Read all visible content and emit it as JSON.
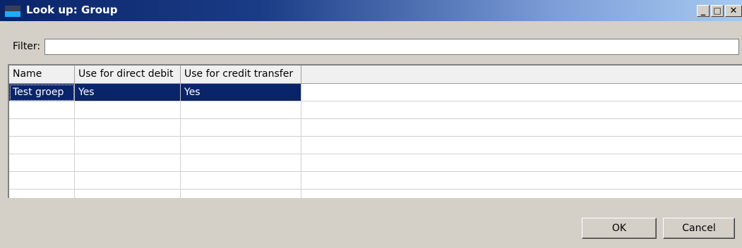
{
  "window": {
    "title": "Look up: Group",
    "minimize_glyph": "_",
    "maximize_glyph": "□",
    "close_glyph": "✕"
  },
  "filter": {
    "label": "Filter:",
    "value": ""
  },
  "table": {
    "columns": [
      "Name",
      "Use for direct debit",
      "Use for credit transfer"
    ],
    "rows": [
      {
        "name": "Test groep",
        "direct_debit": "Yes",
        "credit_transfer": "Yes",
        "selected": true
      }
    ]
  },
  "buttons": {
    "ok": "OK",
    "cancel": "Cancel"
  }
}
